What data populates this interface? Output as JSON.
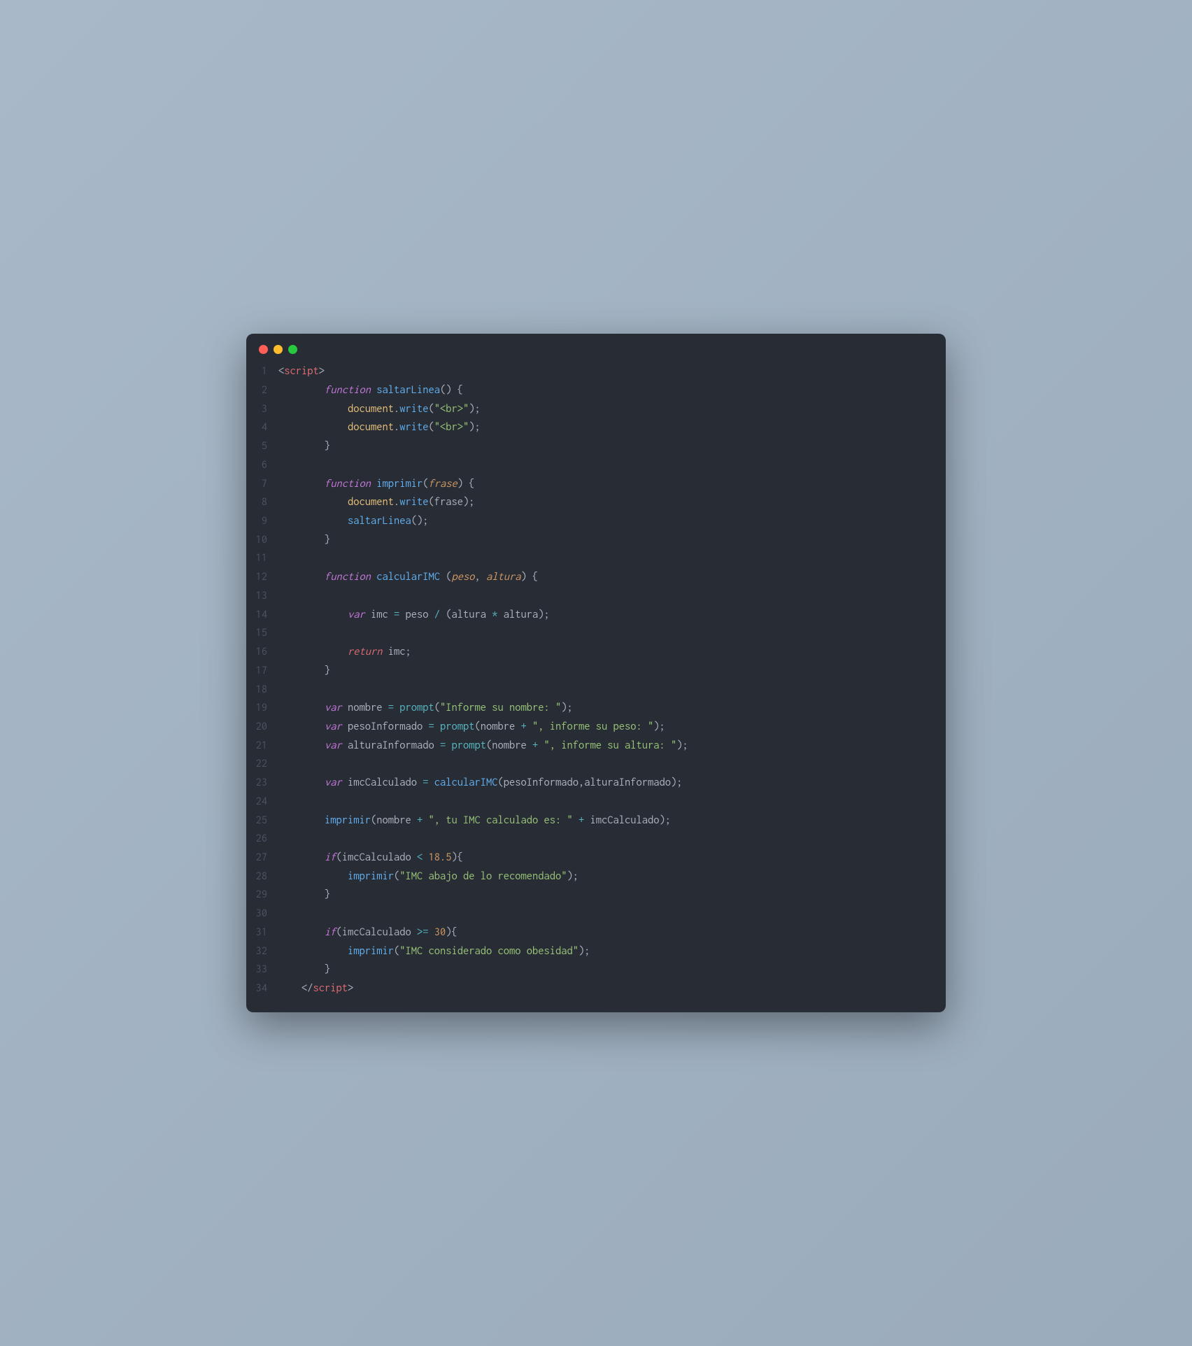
{
  "window": {
    "traffic_lights": [
      "red",
      "yellow",
      "green"
    ]
  },
  "code": {
    "lines": [
      {
        "n": 1,
        "tokens": [
          {
            "t": "<",
            "c": "tag-bracket"
          },
          {
            "t": "script",
            "c": "tag-name"
          },
          {
            "t": ">",
            "c": "tag-bracket"
          }
        ]
      },
      {
        "n": 2,
        "tokens": [
          {
            "t": "        ",
            "c": "plain"
          },
          {
            "t": "function",
            "c": "keyword"
          },
          {
            "t": " ",
            "c": "plain"
          },
          {
            "t": "saltarLinea",
            "c": "func-name"
          },
          {
            "t": "()",
            "c": "punct"
          },
          {
            "t": " ",
            "c": "plain"
          },
          {
            "t": "{",
            "c": "punct"
          }
        ]
      },
      {
        "n": 3,
        "tokens": [
          {
            "t": "            ",
            "c": "plain"
          },
          {
            "t": "document",
            "c": "object"
          },
          {
            "t": ".",
            "c": "punct"
          },
          {
            "t": "write",
            "c": "method"
          },
          {
            "t": "(",
            "c": "punct"
          },
          {
            "t": "\"<br>\"",
            "c": "string"
          },
          {
            "t": ");",
            "c": "punct"
          }
        ]
      },
      {
        "n": 4,
        "tokens": [
          {
            "t": "            ",
            "c": "plain"
          },
          {
            "t": "document",
            "c": "object"
          },
          {
            "t": ".",
            "c": "punct"
          },
          {
            "t": "write",
            "c": "method"
          },
          {
            "t": "(",
            "c": "punct"
          },
          {
            "t": "\"<br>\"",
            "c": "string"
          },
          {
            "t": ");",
            "c": "punct"
          }
        ]
      },
      {
        "n": 5,
        "tokens": [
          {
            "t": "        ",
            "c": "plain"
          },
          {
            "t": "}",
            "c": "punct"
          }
        ]
      },
      {
        "n": 6,
        "tokens": []
      },
      {
        "n": 7,
        "tokens": [
          {
            "t": "        ",
            "c": "plain"
          },
          {
            "t": "function",
            "c": "keyword"
          },
          {
            "t": " ",
            "c": "plain"
          },
          {
            "t": "imprimir",
            "c": "func-name"
          },
          {
            "t": "(",
            "c": "punct"
          },
          {
            "t": "frase",
            "c": "param"
          },
          {
            "t": ")",
            "c": "punct"
          },
          {
            "t": " ",
            "c": "plain"
          },
          {
            "t": "{",
            "c": "punct"
          }
        ]
      },
      {
        "n": 8,
        "tokens": [
          {
            "t": "            ",
            "c": "plain"
          },
          {
            "t": "document",
            "c": "object"
          },
          {
            "t": ".",
            "c": "punct"
          },
          {
            "t": "write",
            "c": "method"
          },
          {
            "t": "(",
            "c": "punct"
          },
          {
            "t": "frase",
            "c": "variable"
          },
          {
            "t": ");",
            "c": "punct"
          }
        ]
      },
      {
        "n": 9,
        "tokens": [
          {
            "t": "            ",
            "c": "plain"
          },
          {
            "t": "saltarLinea",
            "c": "func-call"
          },
          {
            "t": "();",
            "c": "punct"
          }
        ]
      },
      {
        "n": 10,
        "tokens": [
          {
            "t": "        ",
            "c": "plain"
          },
          {
            "t": "}",
            "c": "punct"
          }
        ]
      },
      {
        "n": 11,
        "tokens": []
      },
      {
        "n": 12,
        "tokens": [
          {
            "t": "        ",
            "c": "plain"
          },
          {
            "t": "function",
            "c": "keyword"
          },
          {
            "t": " ",
            "c": "plain"
          },
          {
            "t": "calcularIMC",
            "c": "func-name"
          },
          {
            "t": " ",
            "c": "plain"
          },
          {
            "t": "(",
            "c": "punct"
          },
          {
            "t": "peso",
            "c": "param"
          },
          {
            "t": ",",
            "c": "punct"
          },
          {
            "t": " ",
            "c": "plain"
          },
          {
            "t": "altura",
            "c": "param"
          },
          {
            "t": ")",
            "c": "punct"
          },
          {
            "t": " ",
            "c": "plain"
          },
          {
            "t": "{",
            "c": "punct"
          }
        ]
      },
      {
        "n": 13,
        "tokens": []
      },
      {
        "n": 14,
        "tokens": [
          {
            "t": "            ",
            "c": "plain"
          },
          {
            "t": "var",
            "c": "storage"
          },
          {
            "t": " ",
            "c": "plain"
          },
          {
            "t": "imc",
            "c": "variable"
          },
          {
            "t": " ",
            "c": "plain"
          },
          {
            "t": "=",
            "c": "op"
          },
          {
            "t": " ",
            "c": "plain"
          },
          {
            "t": "peso",
            "c": "variable"
          },
          {
            "t": " ",
            "c": "plain"
          },
          {
            "t": "/",
            "c": "op"
          },
          {
            "t": " ",
            "c": "plain"
          },
          {
            "t": "(",
            "c": "punct"
          },
          {
            "t": "altura",
            "c": "variable"
          },
          {
            "t": " ",
            "c": "plain"
          },
          {
            "t": "*",
            "c": "op"
          },
          {
            "t": " ",
            "c": "plain"
          },
          {
            "t": "altura",
            "c": "variable"
          },
          {
            "t": ");",
            "c": "punct"
          }
        ]
      },
      {
        "n": 15,
        "tokens": []
      },
      {
        "n": 16,
        "tokens": [
          {
            "t": "            ",
            "c": "plain"
          },
          {
            "t": "return",
            "c": "keyword-ret"
          },
          {
            "t": " ",
            "c": "plain"
          },
          {
            "t": "imc",
            "c": "variable"
          },
          {
            "t": ";",
            "c": "punct"
          }
        ]
      },
      {
        "n": 17,
        "tokens": [
          {
            "t": "        ",
            "c": "plain"
          },
          {
            "t": "}",
            "c": "punct"
          }
        ]
      },
      {
        "n": 18,
        "tokens": []
      },
      {
        "n": 19,
        "tokens": [
          {
            "t": "        ",
            "c": "plain"
          },
          {
            "t": "var",
            "c": "storage"
          },
          {
            "t": " ",
            "c": "plain"
          },
          {
            "t": "nombre",
            "c": "variable"
          },
          {
            "t": " ",
            "c": "plain"
          },
          {
            "t": "=",
            "c": "op"
          },
          {
            "t": " ",
            "c": "plain"
          },
          {
            "t": "prompt",
            "c": "builtin"
          },
          {
            "t": "(",
            "c": "punct"
          },
          {
            "t": "\"Informe su nombre: \"",
            "c": "string"
          },
          {
            "t": ");",
            "c": "punct"
          }
        ]
      },
      {
        "n": 20,
        "tokens": [
          {
            "t": "        ",
            "c": "plain"
          },
          {
            "t": "var",
            "c": "storage"
          },
          {
            "t": " ",
            "c": "plain"
          },
          {
            "t": "pesoInformado",
            "c": "variable"
          },
          {
            "t": " ",
            "c": "plain"
          },
          {
            "t": "=",
            "c": "op"
          },
          {
            "t": " ",
            "c": "plain"
          },
          {
            "t": "prompt",
            "c": "builtin"
          },
          {
            "t": "(",
            "c": "punct"
          },
          {
            "t": "nombre",
            "c": "variable"
          },
          {
            "t": " ",
            "c": "plain"
          },
          {
            "t": "+",
            "c": "op"
          },
          {
            "t": " ",
            "c": "plain"
          },
          {
            "t": "\", informe su peso: \"",
            "c": "string"
          },
          {
            "t": ");",
            "c": "punct"
          }
        ]
      },
      {
        "n": 21,
        "tokens": [
          {
            "t": "        ",
            "c": "plain"
          },
          {
            "t": "var",
            "c": "storage"
          },
          {
            "t": " ",
            "c": "plain"
          },
          {
            "t": "alturaInformado",
            "c": "variable"
          },
          {
            "t": " ",
            "c": "plain"
          },
          {
            "t": "=",
            "c": "op"
          },
          {
            "t": " ",
            "c": "plain"
          },
          {
            "t": "prompt",
            "c": "builtin"
          },
          {
            "t": "(",
            "c": "punct"
          },
          {
            "t": "nombre",
            "c": "variable"
          },
          {
            "t": " ",
            "c": "plain"
          },
          {
            "t": "+",
            "c": "op"
          },
          {
            "t": " ",
            "c": "plain"
          },
          {
            "t": "\", informe su altura: \"",
            "c": "string"
          },
          {
            "t": ");",
            "c": "punct"
          }
        ]
      },
      {
        "n": 22,
        "tokens": []
      },
      {
        "n": 23,
        "tokens": [
          {
            "t": "        ",
            "c": "plain"
          },
          {
            "t": "var",
            "c": "storage"
          },
          {
            "t": " ",
            "c": "plain"
          },
          {
            "t": "imcCalculado",
            "c": "variable"
          },
          {
            "t": " ",
            "c": "plain"
          },
          {
            "t": "=",
            "c": "op"
          },
          {
            "t": " ",
            "c": "plain"
          },
          {
            "t": "calcularIMC",
            "c": "func-call"
          },
          {
            "t": "(",
            "c": "punct"
          },
          {
            "t": "pesoInformado",
            "c": "variable"
          },
          {
            "t": ",",
            "c": "punct"
          },
          {
            "t": "alturaInformado",
            "c": "variable"
          },
          {
            "t": ");",
            "c": "punct"
          }
        ]
      },
      {
        "n": 24,
        "tokens": []
      },
      {
        "n": 25,
        "tokens": [
          {
            "t": "        ",
            "c": "plain"
          },
          {
            "t": "imprimir",
            "c": "func-call"
          },
          {
            "t": "(",
            "c": "punct"
          },
          {
            "t": "nombre",
            "c": "variable"
          },
          {
            "t": " ",
            "c": "plain"
          },
          {
            "t": "+",
            "c": "op"
          },
          {
            "t": " ",
            "c": "plain"
          },
          {
            "t": "\", tu IMC calculado es: \"",
            "c": "string"
          },
          {
            "t": " ",
            "c": "plain"
          },
          {
            "t": "+",
            "c": "op"
          },
          {
            "t": " ",
            "c": "plain"
          },
          {
            "t": "imcCalculado",
            "c": "variable"
          },
          {
            "t": ");",
            "c": "punct"
          }
        ]
      },
      {
        "n": 26,
        "tokens": []
      },
      {
        "n": 27,
        "tokens": [
          {
            "t": "        ",
            "c": "plain"
          },
          {
            "t": "if",
            "c": "keyword"
          },
          {
            "t": "(",
            "c": "punct"
          },
          {
            "t": "imcCalculado",
            "c": "variable"
          },
          {
            "t": " ",
            "c": "plain"
          },
          {
            "t": "<",
            "c": "op"
          },
          {
            "t": " ",
            "c": "plain"
          },
          {
            "t": "18.5",
            "c": "number"
          },
          {
            "t": "){",
            "c": "punct"
          }
        ]
      },
      {
        "n": 28,
        "tokens": [
          {
            "t": "            ",
            "c": "plain"
          },
          {
            "t": "imprimir",
            "c": "func-call"
          },
          {
            "t": "(",
            "c": "punct"
          },
          {
            "t": "\"IMC abajo de lo recomendado\"",
            "c": "string"
          },
          {
            "t": ");",
            "c": "punct"
          }
        ]
      },
      {
        "n": 29,
        "tokens": [
          {
            "t": "        ",
            "c": "plain"
          },
          {
            "t": "}",
            "c": "punct"
          }
        ]
      },
      {
        "n": 30,
        "tokens": []
      },
      {
        "n": 31,
        "tokens": [
          {
            "t": "        ",
            "c": "plain"
          },
          {
            "t": "if",
            "c": "keyword"
          },
          {
            "t": "(",
            "c": "punct"
          },
          {
            "t": "imcCalculado",
            "c": "variable"
          },
          {
            "t": " ",
            "c": "plain"
          },
          {
            "t": ">=",
            "c": "op"
          },
          {
            "t": " ",
            "c": "plain"
          },
          {
            "t": "30",
            "c": "number"
          },
          {
            "t": "){",
            "c": "punct"
          }
        ]
      },
      {
        "n": 32,
        "tokens": [
          {
            "t": "            ",
            "c": "plain"
          },
          {
            "t": "imprimir",
            "c": "func-call"
          },
          {
            "t": "(",
            "c": "punct"
          },
          {
            "t": "\"IMC considerado como obesidad\"",
            "c": "string"
          },
          {
            "t": ");",
            "c": "punct"
          }
        ]
      },
      {
        "n": 33,
        "tokens": [
          {
            "t": "        ",
            "c": "plain"
          },
          {
            "t": "}",
            "c": "punct"
          }
        ]
      },
      {
        "n": 34,
        "tokens": [
          {
            "t": "    ",
            "c": "plain"
          },
          {
            "t": "</",
            "c": "tag-bracket"
          },
          {
            "t": "script",
            "c": "tag-name"
          },
          {
            "t": ">",
            "c": "tag-bracket"
          }
        ]
      }
    ]
  }
}
